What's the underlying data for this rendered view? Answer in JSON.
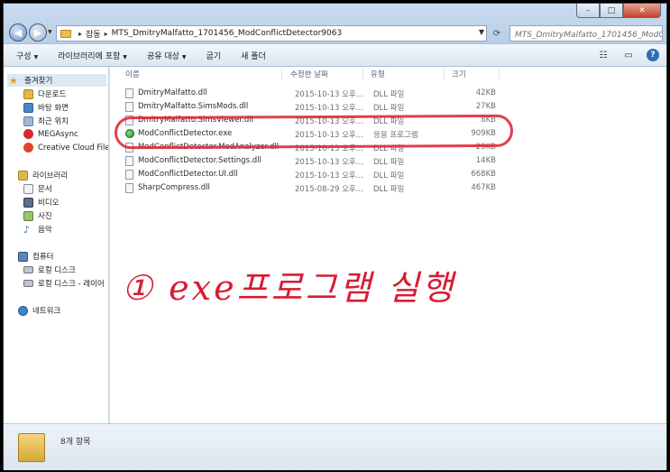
{
  "window": {
    "controls": {
      "minimize": "–",
      "maximize": "□",
      "close": "✕"
    }
  },
  "address_bar": {
    "crumbs": [
      "잡동",
      "MTS_DmitryMalfatto_1701456_ModConflictDetector9063"
    ],
    "separator": "▸",
    "search_placeholder": "MTS_DmitryMalfatto_1701456_ModConflictDetector9063 검색"
  },
  "command_bar": {
    "items": [
      {
        "label": "구성",
        "has_arrow": true
      },
      {
        "label": "라이브러리에 포함",
        "has_arrow": true
      },
      {
        "label": "공유 대상",
        "has_arrow": true
      },
      {
        "label": "굽기",
        "has_arrow": false
      },
      {
        "label": "새 폴더",
        "has_arrow": false
      }
    ],
    "help_label": "?"
  },
  "nav_pane": {
    "favorites": {
      "label": "즐겨찾기",
      "items": [
        "다운로드",
        "바탕 화면",
        "최근 위치",
        "MEGAsync",
        "Creative Cloud Files"
      ]
    },
    "libraries": {
      "label": "라이브러리",
      "items": [
        "문서",
        "비디오",
        "사진",
        "음악"
      ]
    },
    "computer": {
      "label": "컴퓨터",
      "items": [
        "로컬 디스크",
        "로컬 디스크 - 레이어"
      ]
    },
    "network": {
      "label": "네트워크"
    }
  },
  "file_list": {
    "headers": {
      "name": "이름",
      "date": "수정한 날짜",
      "type": "유형",
      "size": "크기"
    },
    "rows": [
      {
        "name": "DmitryMalfatto.dll",
        "date": "2015-10-13 오후...",
        "type": "DLL 파일",
        "size": "42KB",
        "icon": "dll-file-icon"
      },
      {
        "name": "DmitryMalfatto.SimsMods.dll",
        "date": "2015-10-13 오후...",
        "type": "DLL 파일",
        "size": "27KB",
        "icon": "dll-file-icon"
      },
      {
        "name": "DmitryMalfatto.SimsViewer.dll",
        "date": "2015-10-13 오후...",
        "type": "DLL 파일",
        "size": "8KB",
        "icon": "dll-file-icon"
      },
      {
        "name": "ModConflictDetector.exe",
        "date": "2015-10-13 오후...",
        "type": "응용 프로그램",
        "size": "909KB",
        "icon": "exe-file-icon"
      },
      {
        "name": "ModConflictDetector.ModAnalyzer.dll",
        "date": "2015-10-13 오후...",
        "type": "DLL 파일",
        "size": "29KB",
        "icon": "dll-file-icon"
      },
      {
        "name": "ModConflictDetector.Settings.dll",
        "date": "2015-10-13 오후...",
        "type": "DLL 파일",
        "size": "14KB",
        "icon": "dll-file-icon"
      },
      {
        "name": "ModConflictDetector.UI.dll",
        "date": "2015-10-13 오후...",
        "type": "DLL 파일",
        "size": "668KB",
        "icon": "dll-file-icon"
      },
      {
        "name": "SharpCompress.dll",
        "date": "2015-08-29 오후...",
        "type": "DLL 파일",
        "size": "467KB",
        "icon": "dll-file-icon"
      }
    ]
  },
  "annotation": {
    "text": "① exe프로그램 실행",
    "color": "#d81b32"
  },
  "details_pane": {
    "count": "8개 항목"
  }
}
